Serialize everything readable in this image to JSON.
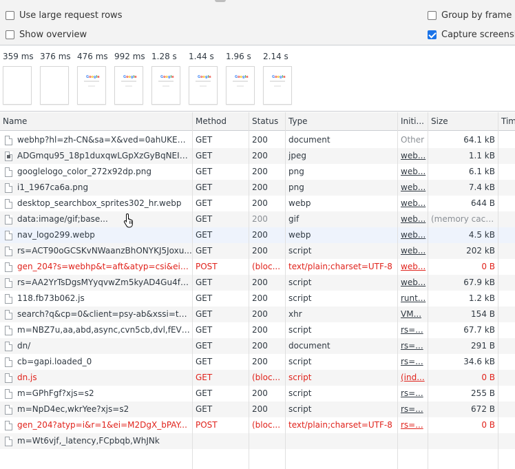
{
  "settings": {
    "use_large_rows": "Use large request rows",
    "show_overview": "Show overview",
    "group_by_frame": "Group by frame",
    "capture_screenshots": "Capture screenshots"
  },
  "overview": {
    "frames": [
      {
        "time": "359 ms"
      },
      {
        "time": "376 ms"
      },
      {
        "time": "476 ms"
      },
      {
        "time": "992 ms"
      },
      {
        "time": "1.28 s"
      },
      {
        "time": "1.44 s"
      },
      {
        "time": "1.96 s"
      },
      {
        "time": "2.14 s"
      }
    ],
    "google_letters": [
      "G",
      "o",
      "o",
      "g",
      "l",
      "e"
    ]
  },
  "table": {
    "headers": {
      "name": "Name",
      "method": "Method",
      "status": "Status",
      "type": "Type",
      "initiator": "Initi...",
      "size": "Size",
      "time": "Tim"
    },
    "rows": [
      {
        "name": "webhp?hl=zh-CN&sa=X&ved=0ahUKEwi...",
        "method": "GET",
        "status": "200",
        "type": "document",
        "initiator": "Other",
        "size": "64.1 kB"
      },
      {
        "name": "ADGmqu95_18p1duxqwLGpXzGyBqNEIh...",
        "method": "GET",
        "status": "200",
        "type": "jpeg",
        "initiator": "web...",
        "size": "1.1 kB"
      },
      {
        "name": "googlelogo_color_272x92dp.png",
        "method": "GET",
        "status": "200",
        "type": "png",
        "initiator": "web...",
        "size": "6.1 kB"
      },
      {
        "name": "i1_1967ca6a.png",
        "method": "GET",
        "status": "200",
        "type": "png",
        "initiator": "web...",
        "size": "7.4 kB"
      },
      {
        "name": "desktop_searchbox_sprites302_hr.webp",
        "method": "GET",
        "status": "200",
        "type": "webp",
        "initiator": "web...",
        "size": "644 B"
      },
      {
        "name": "data:image/gif;base...",
        "method": "GET",
        "status": "200",
        "type": "gif",
        "initiator": "web...",
        "size": "(memory cach..."
      },
      {
        "name": "nav_logo299.webp",
        "method": "GET",
        "status": "200",
        "type": "webp",
        "initiator": "web...",
        "size": "4.5 kB"
      },
      {
        "name": "rs=ACT90oGCSKvNWaanzBhONYKJ5Joxu...",
        "method": "GET",
        "status": "200",
        "type": "script",
        "initiator": "web...",
        "size": "202 kB"
      },
      {
        "name": "gen_204?s=webhp&t=aft&atyp=csi&ei=...",
        "method": "POST",
        "status": "(bloc...",
        "type": "text/plain;charset=UTF-8",
        "initiator": "web...",
        "size": "0 B"
      },
      {
        "name": "rs=AA2YrTsDgsMYyqvwZm5kyAD4Gu4fv...",
        "method": "GET",
        "status": "200",
        "type": "script",
        "initiator": "web...",
        "size": "67.9 kB"
      },
      {
        "name": "118.fb73b062.js",
        "method": "GET",
        "status": "200",
        "type": "script",
        "initiator": "runt...",
        "size": "1.2 kB"
      },
      {
        "name": "search?q&cp=0&client=psy-ab&xssi=t&...",
        "method": "GET",
        "status": "200",
        "type": "xhr",
        "initiator": "VM...",
        "size": "154 B"
      },
      {
        "name": "m=NBZ7u,aa,abd,async,cvn5cb,dvl,fEVMi...",
        "method": "GET",
        "status": "200",
        "type": "script",
        "initiator": "rs=...",
        "size": "67.7 kB"
      },
      {
        "name": "dn/",
        "method": "GET",
        "status": "200",
        "type": "document",
        "initiator": "rs=...",
        "size": "291 B"
      },
      {
        "name": "cb=gapi.loaded_0",
        "method": "GET",
        "status": "200",
        "type": "script",
        "initiator": "rs=...",
        "size": "34.6 kB"
      },
      {
        "name": "dn.js",
        "method": "GET",
        "status": "(bloc...",
        "type": "script",
        "initiator": "(ind...",
        "size": "0 B"
      },
      {
        "name": "m=GPhFgf?xjs=s2",
        "method": "GET",
        "status": "200",
        "type": "script",
        "initiator": "rs=...",
        "size": "255 B"
      },
      {
        "name": "m=NpD4ec,wkrYee?xjs=s2",
        "method": "GET",
        "status": "200",
        "type": "script",
        "initiator": "rs=...",
        "size": "672 B"
      },
      {
        "name": "gen_204?atyp=i&r=1&ei=M2DgX_bPAY...",
        "method": "POST",
        "status": "(bloc...",
        "type": "text/plain;charset=UTF-8",
        "initiator": "rs=...",
        "size": "0 B"
      },
      {
        "name": "m=Wt6vjf,_latency,FCpbqb,WhJNk",
        "method": "",
        "status": "",
        "type": "",
        "initiator": "",
        "size": ""
      }
    ]
  }
}
